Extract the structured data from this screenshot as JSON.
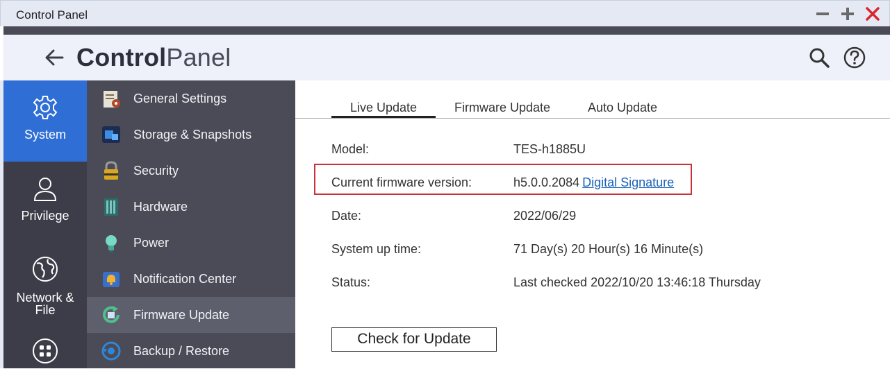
{
  "window": {
    "title": "Control Panel"
  },
  "header": {
    "title_bold": "Control",
    "title_light": "Panel"
  },
  "rail": {
    "items": [
      {
        "label": "System",
        "icon": "gear-icon",
        "active": true
      },
      {
        "label": "Privilege",
        "icon": "user-icon"
      },
      {
        "label_line1": "Network &",
        "label_line2": "File",
        "icon": "globe-icon"
      },
      {
        "label": "",
        "icon": "apps-grid-icon"
      }
    ]
  },
  "submenu": {
    "items": [
      {
        "label": "General Settings",
        "icon": "general-settings-icon"
      },
      {
        "label": "Storage & Snapshots",
        "icon": "storage-icon"
      },
      {
        "label": "Security",
        "icon": "lock-icon"
      },
      {
        "label": "Hardware",
        "icon": "hardware-icon"
      },
      {
        "label": "Power",
        "icon": "power-bulb-icon"
      },
      {
        "label": "Notification Center",
        "icon": "notification-icon"
      },
      {
        "label": "Firmware Update",
        "icon": "firmware-update-icon",
        "active": true
      },
      {
        "label": "Backup / Restore",
        "icon": "backup-icon"
      }
    ]
  },
  "tabs": [
    {
      "label": "Live Update",
      "active": true
    },
    {
      "label": "Firmware Update"
    },
    {
      "label": "Auto Update"
    }
  ],
  "info": {
    "model_label": "Model:",
    "model_value": "TES-h1885U",
    "fw_label": "Current firmware version:",
    "fw_value": "h5.0.0.2084",
    "signature_link": "Digital Signature",
    "date_label": "Date:",
    "date_value": "2022/06/29",
    "uptime_label": "System up time:",
    "uptime_value": "71 Day(s) 20 Hour(s) 16 Minute(s)",
    "status_label": "Status:",
    "status_value": "Last checked 2022/10/20 13:46:18 Thursday"
  },
  "actions": {
    "check_label": "Check for Update"
  },
  "colors": {
    "accent": "#2f6fd5",
    "close": "#d9262c",
    "highlight": "#c8323a",
    "link": "#1a63b8"
  }
}
